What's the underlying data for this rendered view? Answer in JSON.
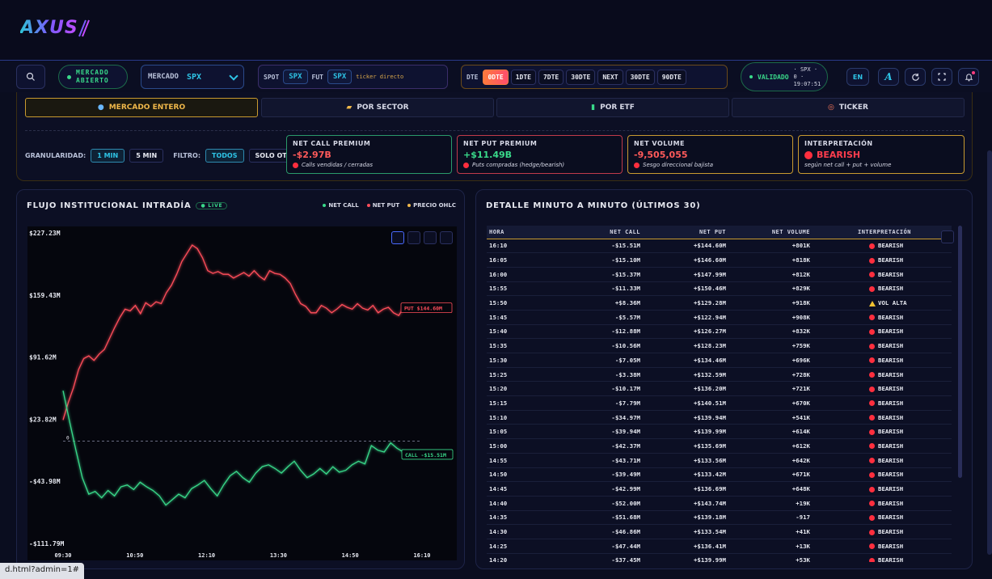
{
  "app": {
    "logo": "AXUS",
    "status_url": "d.html?admin=1#"
  },
  "toolbar": {
    "market_status": "MERCADO ABIERTO",
    "mercado_label": "MERCADO",
    "mercado_value": "SPX",
    "spot_label": "SPOT",
    "spot_value": "SPX",
    "fut_label": "FUT",
    "fut_value": "SPX",
    "ticker_hint": "ticker directo",
    "dte_label": "DTE",
    "dte_options": [
      "0DTE",
      "1DTE",
      "7DTE",
      "30DTE",
      "NEXT",
      "30DTE",
      "90DTE"
    ],
    "dte_active": "0DTE",
    "validado_label": "VALIDADO",
    "validado_meta": [
      "· SPX ·",
      "0 ·",
      "19:07:51"
    ],
    "lang": "EN",
    "font_icon": "A",
    "colors": {
      "accent": "#2ec4e6",
      "green": "#39d98a",
      "orange": "#ff7a3d"
    }
  },
  "scope": {
    "tabs": [
      {
        "icon": "●",
        "label": "MERCADO ENTERO"
      },
      {
        "icon": "▰",
        "label": "POR SECTOR"
      },
      {
        "icon": "▮",
        "label": "POR ETF"
      },
      {
        "icon": "◎",
        "label": "TICKER"
      }
    ],
    "granularidad_label": "GRANULARIDAD:",
    "gran_options": [
      "1 MIN",
      "5 MIN"
    ],
    "filtro_label": "FILTRO:",
    "filtro_options": [
      "TODOS",
      "SOLO OTM"
    ]
  },
  "metrics": [
    {
      "label": "NET CALL PREMIUM",
      "value": "-$2.97B",
      "sub": "Calls vendidas / cerradas",
      "color": "#ff5a5a",
      "border": "#2a9a6a"
    },
    {
      "label": "NET PUT PREMIUM",
      "value": "+$11.49B",
      "sub": "Puts compradas (hedge/bearish)",
      "color": "#39d98a",
      "border": "#c03a4a"
    },
    {
      "label": "NET VOLUME",
      "value": "-9,505,055",
      "sub": "Sesgo direccional bajista",
      "color": "#ff5a5a",
      "border": "#c89a30"
    },
    {
      "label": "INTERPRETACIÓN",
      "value": "BEARISH",
      "sub": "según net call + put + volume",
      "color": "#ff3d4d",
      "border": "#c89a30"
    }
  ],
  "chart_panel": {
    "title": "FLUJO INSTITUCIONAL INTRADÍA",
    "live": "LIVE",
    "legend": [
      {
        "label": "NET CALL",
        "color": "#39d98a"
      },
      {
        "label": "NET PUT",
        "color": "#ff4d5a"
      },
      {
        "label": "PRECIO OHLC",
        "color": "#f0b84a"
      }
    ]
  },
  "chart_data": {
    "type": "line",
    "y_ticks": [
      "$227.23M",
      "$159.43M",
      "$91.62M",
      "$23.82M",
      "-$43.98M",
      "-$111.79M"
    ],
    "y_tick_values": [
      227.23,
      159.43,
      91.62,
      23.82,
      -43.98,
      -111.79
    ],
    "x_ticks": [
      "09:30",
      "10:50",
      "12:10",
      "13:30",
      "14:50",
      "16:10"
    ],
    "ylim": [
      -111.79,
      227.23
    ],
    "zero_label": "0",
    "series": [
      {
        "name": "NET PUT",
        "color": "#ff4d5a",
        "end_label": "PUT $144.60M",
        "values": [
          23,
          42,
          58,
          78,
          90,
          93,
          88,
          95,
          100,
          112,
          124,
          135,
          144,
          142,
          148,
          139,
          151,
          147,
          152,
          150,
          162,
          170,
          182,
          196,
          205,
          214,
          210,
          200,
          186,
          183,
          185,
          182,
          182,
          178,
          181,
          184,
          180,
          186,
          180,
          176,
          186,
          183,
          182,
          178,
          172,
          160,
          150,
          147,
          140,
          140,
          148,
          145,
          140,
          144,
          149,
          146,
          144,
          150,
          145,
          143,
          148,
          140,
          144,
          146,
          140,
          137,
          146,
          144.6
        ]
      },
      {
        "name": "NET CALL",
        "color": "#39d98a",
        "end_label": "CALL -$15.51M",
        "values": [
          55,
          22,
          -10,
          -40,
          -58,
          -55,
          -62,
          -54,
          -60,
          -50,
          -48,
          -53,
          -45,
          -50,
          -54,
          -60,
          -70,
          -64,
          -58,
          -62,
          -52,
          -48,
          -43,
          -52,
          -60,
          -48,
          -38,
          -33,
          -40,
          -45,
          -35,
          -28,
          -26,
          -30,
          -35,
          -28,
          -22,
          -32,
          -40,
          -36,
          -30,
          -36,
          -28,
          -34,
          -32,
          -26,
          -22,
          -25,
          -5,
          -10,
          -12,
          -2,
          -8,
          -12,
          -15.5
        ]
      }
    ]
  },
  "table_panel": {
    "title": "DETALLE MINUTO A MINUTO (ÚLTIMOS 30)",
    "columns": [
      "HORA",
      "NET CALL",
      "NET PUT",
      "NET VOLUME",
      "INTERPRETACIÓN"
    ],
    "rows": [
      [
        "16:10",
        "-$15.51M",
        "+$144.60M",
        "+801K",
        "BEARISH"
      ],
      [
        "16:05",
        "-$15.10M",
        "+$146.60M",
        "+818K",
        "BEARISH"
      ],
      [
        "16:00",
        "-$15.37M",
        "+$147.99M",
        "+812K",
        "BEARISH"
      ],
      [
        "15:55",
        "-$11.33M",
        "+$150.46M",
        "+829K",
        "BEARISH"
      ],
      [
        "15:50",
        "+$8.36M",
        "+$129.28M",
        "+918K",
        "VOL ALTA"
      ],
      [
        "15:45",
        "-$5.57M",
        "+$122.94M",
        "+908K",
        "BEARISH"
      ],
      [
        "15:40",
        "-$12.88M",
        "+$126.27M",
        "+832K",
        "BEARISH"
      ],
      [
        "15:35",
        "-$10.56M",
        "+$128.23M",
        "+759K",
        "BEARISH"
      ],
      [
        "15:30",
        "-$7.05M",
        "+$134.46M",
        "+696K",
        "BEARISH"
      ],
      [
        "15:25",
        "-$3.38M",
        "+$132.59M",
        "+728K",
        "BEARISH"
      ],
      [
        "15:20",
        "-$10.17M",
        "+$136.20M",
        "+721K",
        "BEARISH"
      ],
      [
        "15:15",
        "-$7.79M",
        "+$140.51M",
        "+670K",
        "BEARISH"
      ],
      [
        "15:10",
        "-$34.97M",
        "+$139.94M",
        "+541K",
        "BEARISH"
      ],
      [
        "15:05",
        "-$39.94M",
        "+$139.99M",
        "+614K",
        "BEARISH"
      ],
      [
        "15:00",
        "-$42.37M",
        "+$135.69M",
        "+612K",
        "BEARISH"
      ],
      [
        "14:55",
        "-$43.71M",
        "+$133.56M",
        "+642K",
        "BEARISH"
      ],
      [
        "14:50",
        "-$39.49M",
        "+$133.42M",
        "+671K",
        "BEARISH"
      ],
      [
        "14:45",
        "-$42.99M",
        "+$136.69M",
        "+648K",
        "BEARISH"
      ],
      [
        "14:40",
        "-$52.00M",
        "+$143.74M",
        "+19K",
        "BEARISH"
      ],
      [
        "14:35",
        "-$51.68M",
        "+$139.18M",
        "-917",
        "BEARISH"
      ],
      [
        "14:30",
        "-$46.86M",
        "+$133.54M",
        "+41K",
        "BEARISH"
      ],
      [
        "14:25",
        "-$47.44M",
        "+$136.41M",
        "+13K",
        "BEARISH"
      ],
      [
        "14:20",
        "-$37.45M",
        "+$139.99M",
        "+53K",
        "BEARISH"
      ]
    ]
  }
}
